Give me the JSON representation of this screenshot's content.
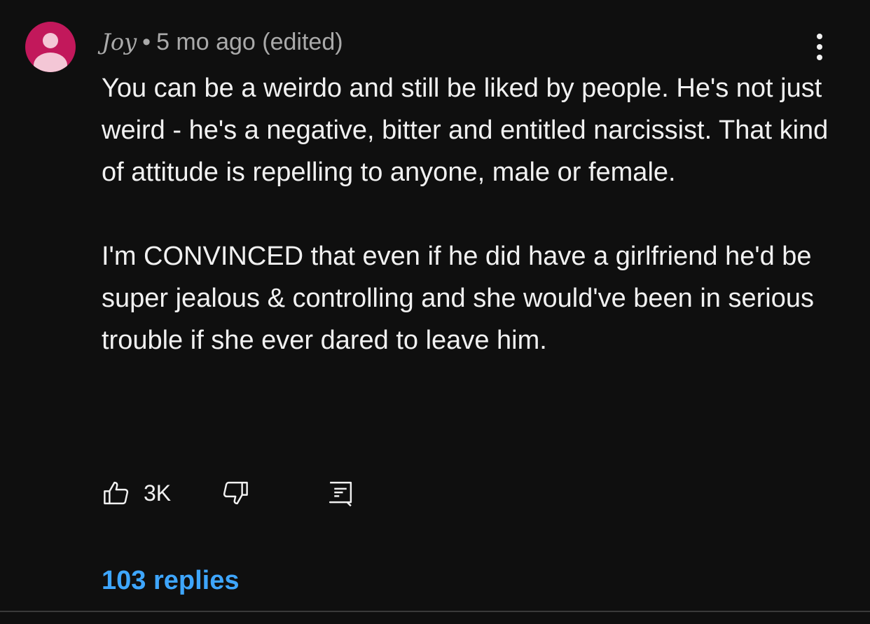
{
  "comment": {
    "author": "Joy",
    "separator": "•",
    "timestamp": "5 mo ago (edited)",
    "paragraphs": [
      "You can be a weirdo and still be liked by people. He's not just weird - he's a negative, bitter and entitled narcissist. That kind of attitude is repelling to anyone, male or female.",
      "I'm CONVINCED that even if he did have a girlfriend he'd be super jealous & controlling and she would've been in serious trouble if she ever dared to leave him."
    ],
    "like_count": "3K",
    "replies_label": "103 replies"
  },
  "icons": {
    "avatar": "person-silhouette-icon",
    "more": "vertical-dots-icon",
    "like": "thumbs-up-icon",
    "dislike": "thumbs-down-icon",
    "reply": "comment-reply-icon"
  },
  "colors": {
    "background": "#0f0f0f",
    "text": "#f1f1f1",
    "secondary_text": "#aaaaaa",
    "link": "#3ea6ff",
    "avatar_bg": "#c2185b",
    "avatar_figure": "#f4c7d6"
  }
}
